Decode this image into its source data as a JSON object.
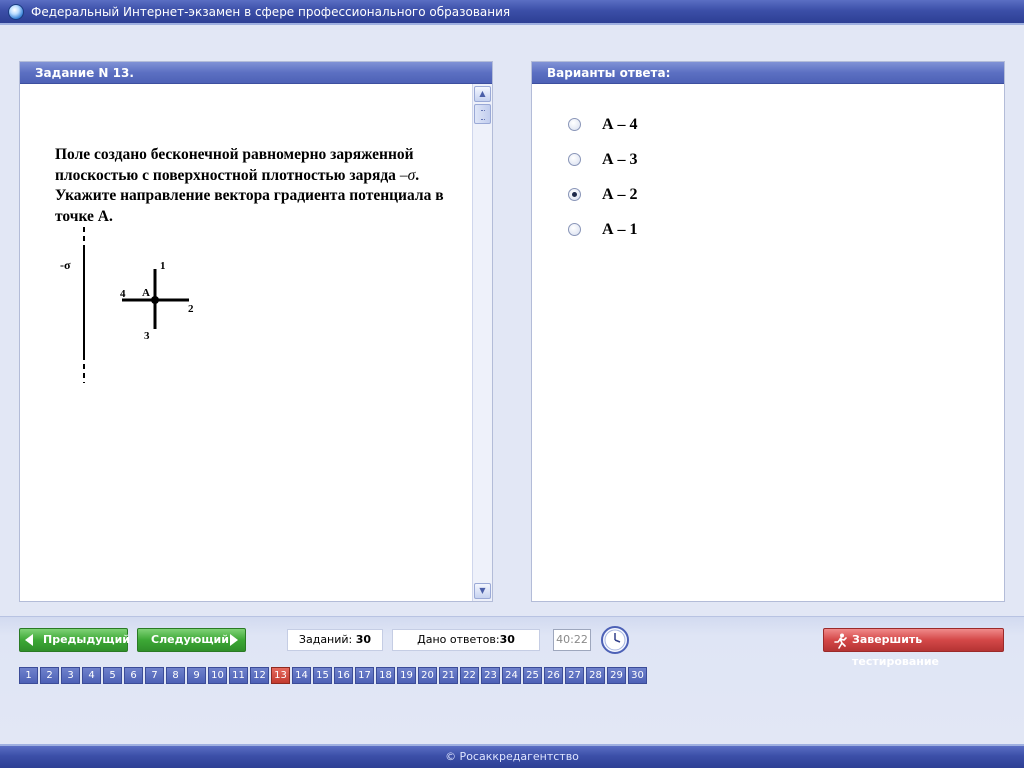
{
  "window": {
    "title": "Федеральный Интернет-экзамен в сфере профессионального образования"
  },
  "task": {
    "header": "Задание N 13.",
    "question_part1": "Поле создано бесконечной равномерно заряженной плоскостью с поверхностной плотностью заряда ",
    "question_symbol": "–σ",
    "question_part2": ". Укажите направление вектора градиента потенциала в точке А.",
    "figure": {
      "plane_label": "-σ",
      "point_label": "А",
      "dir1": "1",
      "dir2": "2",
      "dir3": "3",
      "dir4": "4"
    }
  },
  "answers": {
    "header": "Варианты ответа:",
    "options": [
      {
        "label": "А – 4",
        "checked": false
      },
      {
        "label": "А – 3",
        "checked": false
      },
      {
        "label": "А – 2",
        "checked": true
      },
      {
        "label": "А – 1",
        "checked": false
      }
    ]
  },
  "navigation": {
    "prev_label": "Предыдущий",
    "next_label": "Следующий",
    "tasks_label": "Заданий:",
    "tasks_count": "30",
    "answered_label": "Дано ответов:",
    "answered_count": "30",
    "timer": "40:22",
    "finish_label": "Завершить тестирование"
  },
  "pager": {
    "pages": [
      "1",
      "2",
      "3",
      "4",
      "5",
      "6",
      "7",
      "8",
      "9",
      "10",
      "11",
      "12",
      "13",
      "14",
      "15",
      "16",
      "17",
      "18",
      "19",
      "20",
      "21",
      "22",
      "23",
      "24",
      "25",
      "26",
      "27",
      "28",
      "29",
      "30"
    ],
    "current": "13"
  },
  "footer": {
    "text": "© Росаккредагентство"
  },
  "colors": {
    "header_blue": "#4d61b6",
    "nav_green": "#3da836",
    "finish_red": "#d44848",
    "current_page_red": "#c23a2e"
  }
}
